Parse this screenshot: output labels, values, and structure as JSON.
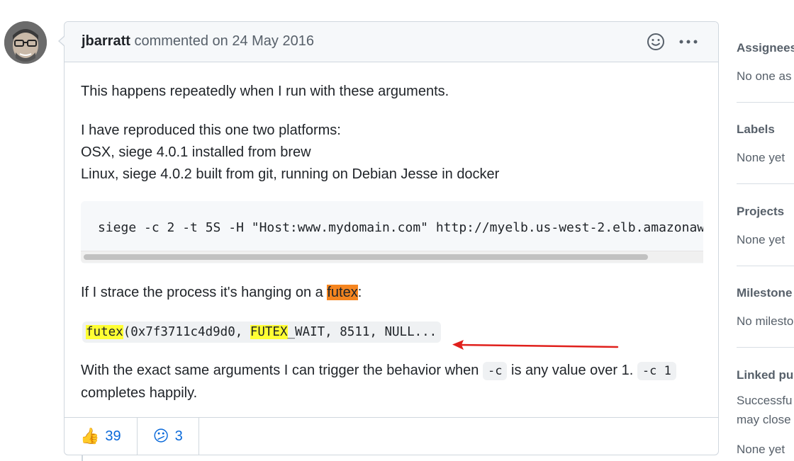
{
  "comment": {
    "author": "jbarratt",
    "action_text": " commented on 24 May 2016",
    "paragraph1": "This happens repeatedly when I run with these arguments.",
    "paragraph2_lines": [
      "I have reproduced this one two platforms:",
      "OSX, siege 4.0.1 installed from brew",
      "Linux, siege 4.0.2 built from git, running on Debian Jesse in docker"
    ],
    "code_block": "siege -c 2 -t 5S -H \"Host:www.mydomain.com\" http://myelb.us-west-2.elb.amazonaw",
    "paragraph3_prefix": "If I strace the process it's hanging on a ",
    "paragraph3_highlight": "futex",
    "paragraph3_suffix": ":",
    "strace_line": {
      "hl1": "futex",
      "part1": "(0x7f3711c4d9d0, ",
      "hl2": "FUTEX",
      "part2": "_WAIT, 8511, NULL..."
    },
    "paragraph4": {
      "before": "With the exact same arguments I can trigger the behavior when ",
      "code1": "-c",
      "middle": " is any value over 1. ",
      "code2": "-c 1",
      "after": " completes happily."
    },
    "reactions": [
      {
        "icon": "thumbs-up-icon",
        "emoji": "👍",
        "count": "39"
      },
      {
        "icon": "confused-face-icon",
        "emoji": "😕",
        "count": "3"
      }
    ]
  },
  "sidebar": {
    "sections": [
      {
        "title": "Assignees",
        "value": "No one as"
      },
      {
        "title": "Labels",
        "value": "None yet"
      },
      {
        "title": "Projects",
        "value": "None yet"
      },
      {
        "title": "Milestone",
        "value": "No milesto"
      },
      {
        "title": "Linked pu",
        "value_lines": [
          "Successfu",
          "may close"
        ],
        "value2": "None yet"
      }
    ]
  },
  "colors": {
    "link_blue": "#0969da",
    "highlight_orange": "#f5851f",
    "highlight_yellow": "#ffff33",
    "arrow_red": "#e0201c"
  }
}
